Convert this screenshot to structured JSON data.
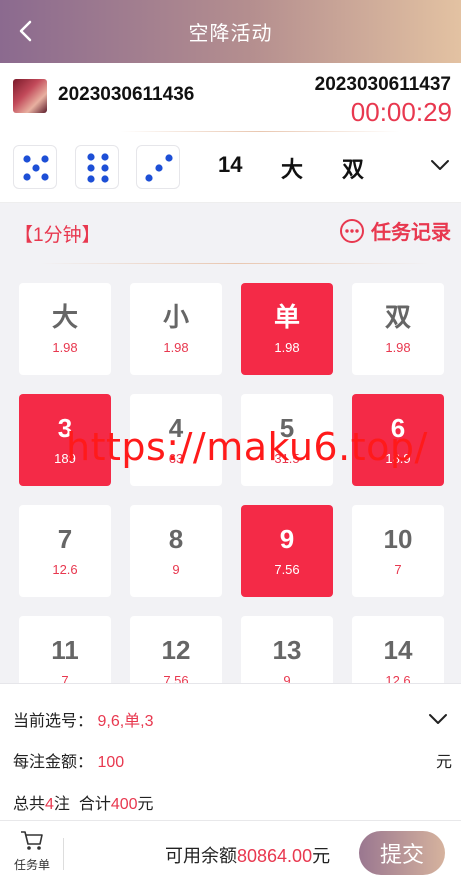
{
  "header": {
    "title": "空降活动",
    "back_icon": "chevron-left-icon"
  },
  "issue": {
    "current": "2023030611436",
    "next": "2023030611437",
    "countdown": "00:00:29"
  },
  "last_result": {
    "dice": [
      5,
      6,
      3
    ],
    "sum": "14",
    "size": "大",
    "parity": "双"
  },
  "rule_name": "【1分钟】",
  "task_record_label": "任务记录",
  "options": [
    {
      "label": "大",
      "odds": "1.98",
      "selected": false
    },
    {
      "label": "小",
      "odds": "1.98",
      "selected": false
    },
    {
      "label": "单",
      "odds": "1.98",
      "selected": true
    },
    {
      "label": "双",
      "odds": "1.98",
      "selected": false
    },
    {
      "label": "3",
      "odds": "189",
      "selected": true
    },
    {
      "label": "4",
      "odds": "63",
      "selected": false
    },
    {
      "label": "5",
      "odds": "31.5",
      "selected": false
    },
    {
      "label": "6",
      "odds": "18.9",
      "selected": true
    },
    {
      "label": "7",
      "odds": "12.6",
      "selected": false
    },
    {
      "label": "8",
      "odds": "9",
      "selected": false
    },
    {
      "label": "9",
      "odds": "7.56",
      "selected": true
    },
    {
      "label": "10",
      "odds": "7",
      "selected": false
    },
    {
      "label": "11",
      "odds": "7",
      "selected": false
    },
    {
      "label": "12",
      "odds": "7.56",
      "selected": false
    },
    {
      "label": "13",
      "odds": "9",
      "selected": false
    },
    {
      "label": "14",
      "odds": "12.6",
      "selected": false
    }
  ],
  "watermark": "https://maku6.top/",
  "form": {
    "selected_label": "当前选号：",
    "selected_value": "9,6,单,3",
    "amount_label": "每注金额：",
    "amount_value": "100",
    "amount_unit": "元",
    "total_prefix": "总共",
    "total_count": "4",
    "total_mid": "注  合计",
    "total_amount": "400",
    "total_unit": "元"
  },
  "footer": {
    "cart_label": "任务单",
    "balance_label": "可用余额",
    "balance_value": "80864.00",
    "balance_unit": "元",
    "submit_label": "提交"
  },
  "colors": {
    "accent": "#e8384f",
    "selected_cell": "#f42a47",
    "header_start": "#8b6a8f",
    "header_end": "#e3c2a2"
  }
}
